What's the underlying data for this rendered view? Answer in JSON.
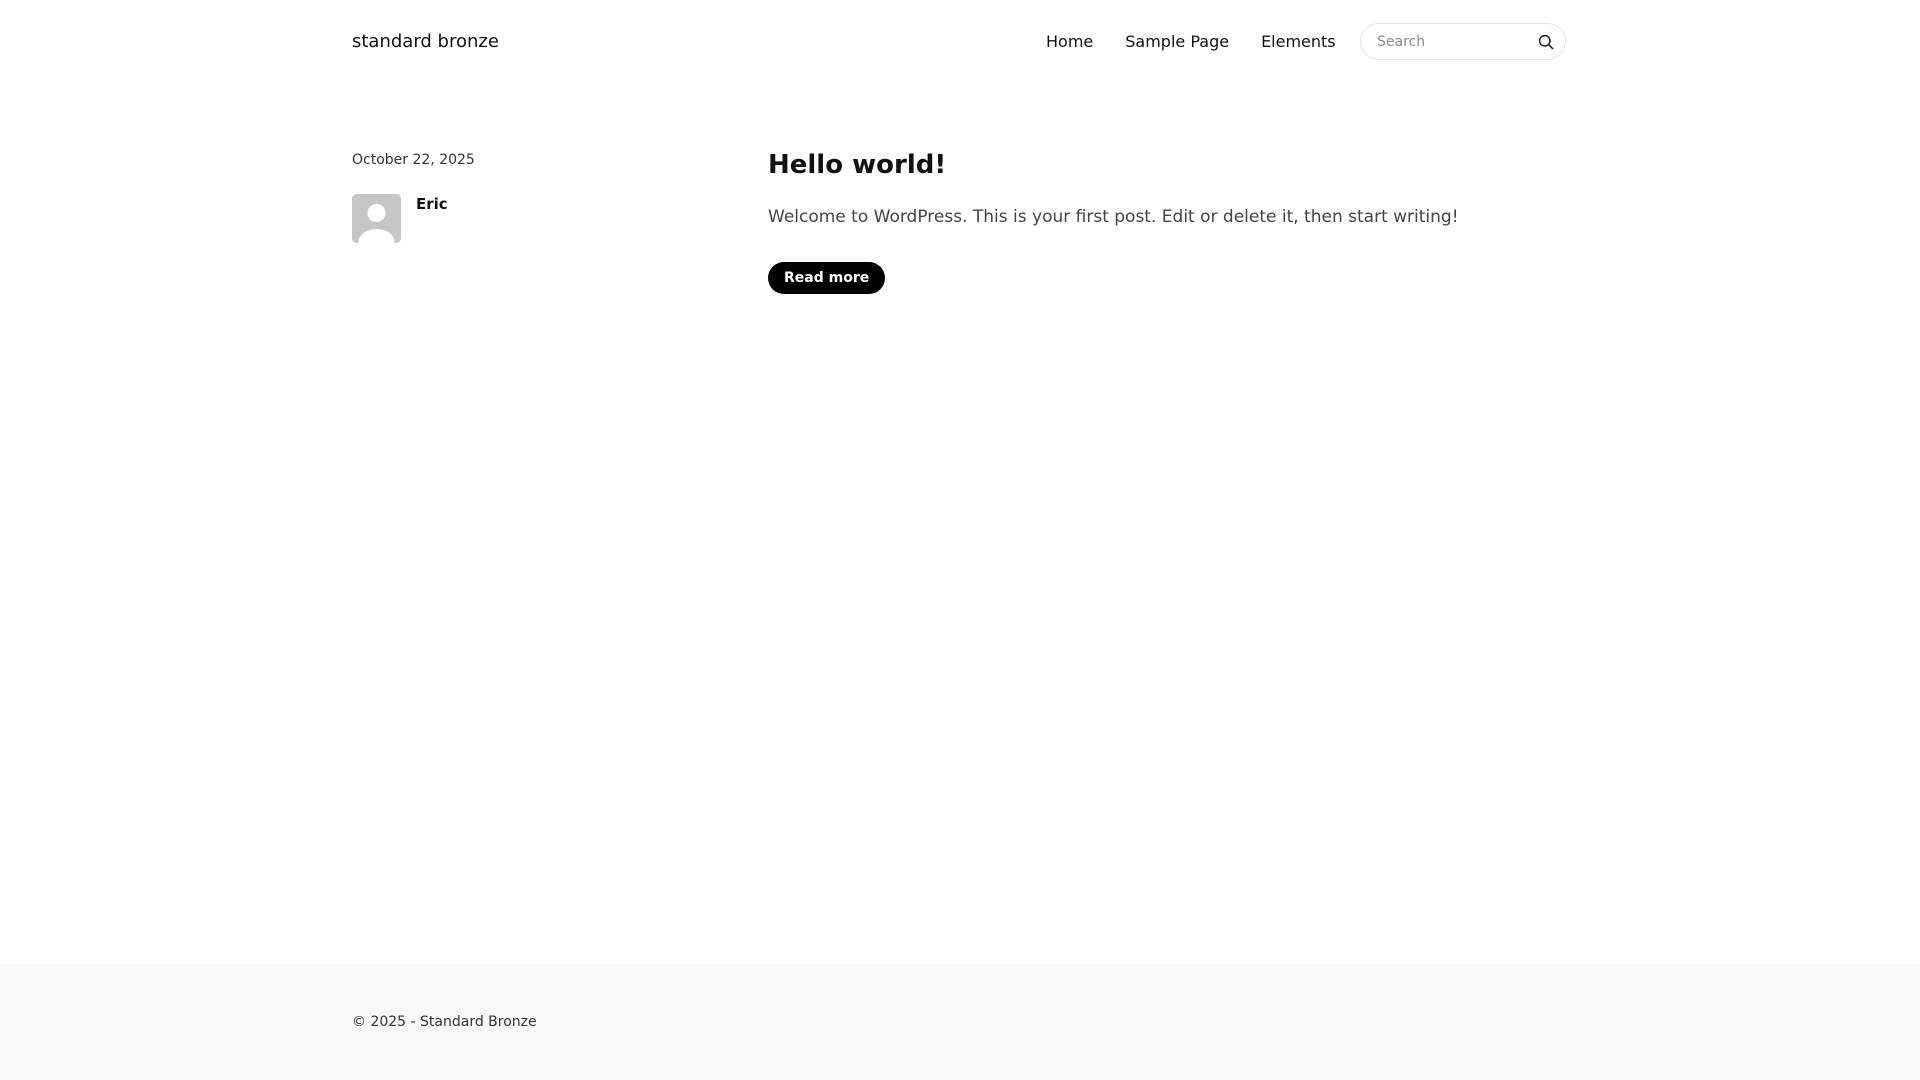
{
  "header": {
    "site_title": "standard bronze",
    "nav": [
      {
        "label": "Home"
      },
      {
        "label": "Sample Page"
      },
      {
        "label": "Elements"
      }
    ],
    "search": {
      "placeholder": "Search",
      "value": "",
      "icon": "search-icon"
    }
  },
  "post": {
    "date": "October 22, 2025",
    "author": "Eric",
    "avatar_icon": "avatar-placeholder-icon",
    "title": "Hello world!",
    "excerpt": "Welcome to WordPress. This is your first post. Edit or delete it, then start writing!",
    "read_more_label": "Read more"
  },
  "footer": {
    "copyright": "© 2025 - Standard Bronze"
  },
  "colors": {
    "background": "#ffffff",
    "text": "#111111",
    "button_bg": "#000000",
    "button_text": "#ffffff",
    "footer_bg": "#f8f8f8",
    "avatar_bg": "#c6c6c6"
  }
}
